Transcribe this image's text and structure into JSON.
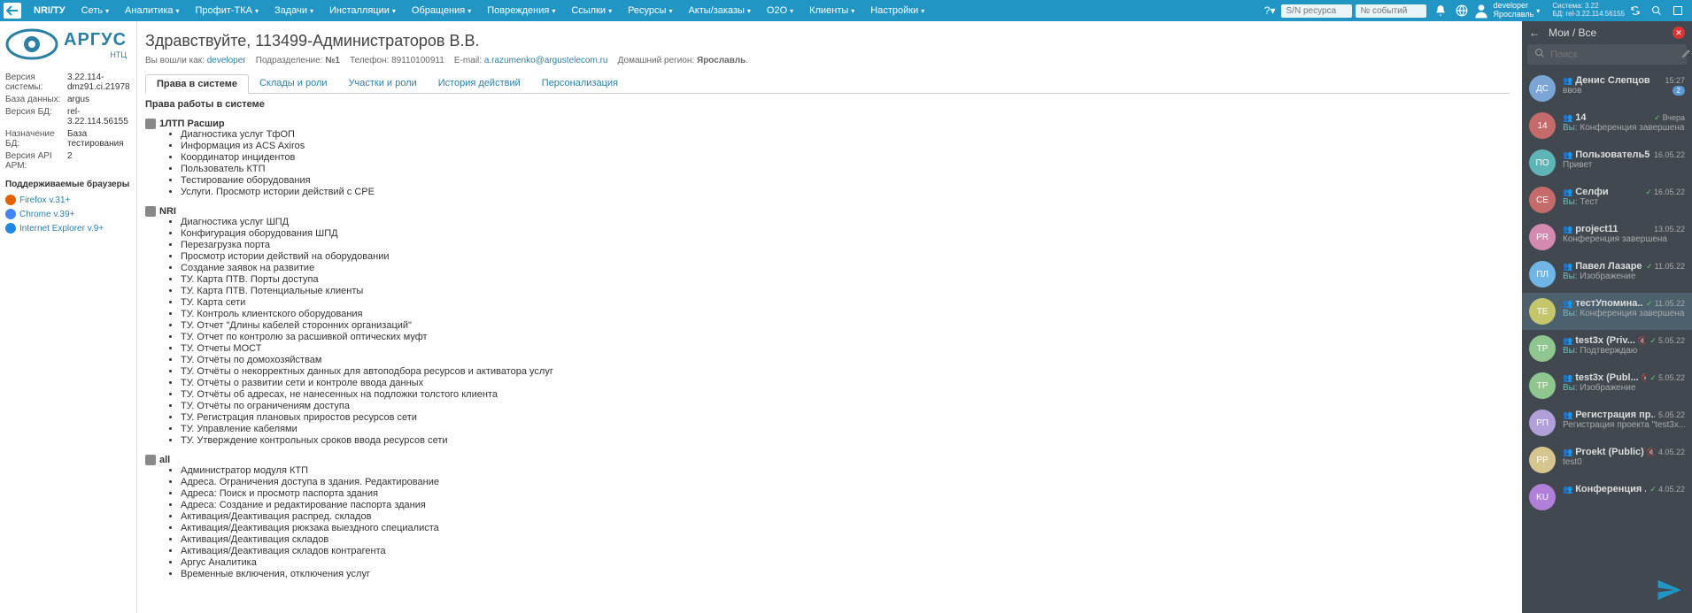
{
  "topbar": {
    "home": "NRI/ТУ",
    "menu": [
      "Сеть",
      "Аналитика",
      "Профит-ТКА",
      "Задачи",
      "Инсталляции",
      "Обращения",
      "Повреждения",
      "Ссылки",
      "Ресурсы",
      "Акты/заказы",
      "О2О",
      "Клиенты",
      "Настройки"
    ],
    "help": "?",
    "search1_ph": "S/N ресурса",
    "search2_ph": "№ событий",
    "user_name": "developer",
    "user_loc": "Ярославль",
    "sys1": "Система: 3.22",
    "sys2": "БД: rel-3.22.114.56155"
  },
  "left": {
    "brand": "АРГУС",
    "brand_sub": "НТЦ",
    "rows": [
      {
        "l": "Версия системы:",
        "v": "3.22.114-dmz91.ci.21978"
      },
      {
        "l": "База данных:",
        "v": "argus"
      },
      {
        "l": "Версия БД:",
        "v": "rel-3.22.114.56155"
      },
      {
        "l": "Назначение БД:",
        "v": "База тестирования"
      },
      {
        "l": "Версия API АРМ:",
        "v": "2"
      }
    ],
    "browsers_h": "Поддерживаемые браузеры",
    "browsers": [
      {
        "n": "Firefox v.31+",
        "c": "#e66000"
      },
      {
        "n": "Chrome v.39+",
        "c": "#4285f4"
      },
      {
        "n": "Internet Explorer v.9+",
        "c": "#1e88e5"
      }
    ]
  },
  "main": {
    "greeting": "Здравствуйте, 113499-Администраторов В.В.",
    "meta_login_l": "Вы вошли как: ",
    "meta_login_v": "developer",
    "meta_dep_l": "Подразделение: ",
    "meta_dep_v": "№1",
    "meta_tel_l": "Телефон: ",
    "meta_tel_v": "89110100911",
    "meta_mail_l": "E-mail: ",
    "meta_mail_v": "a.razumenko@argustelecom.ru",
    "meta_reg_l": "Домашний регион: ",
    "meta_reg_v": "Ярославль",
    "tabs": [
      "Права в системе",
      "Склады и роли",
      "Участки и роли",
      "История действий",
      "Персонализация"
    ],
    "section_title": "Права работы в системе",
    "groups": [
      {
        "h": "1ЛТП Расшир",
        "items": [
          "Диагностика услуг ТфОП",
          "Информация из ACS Axiros",
          "Координатор инцидентов",
          "Пользователь КТП",
          "Тестирование оборудования",
          "Услуги. Просмотр истории действий с CPE"
        ]
      },
      {
        "h": "NRI",
        "items": [
          "Диагностика услуг ШПД",
          "Конфигурация оборудования ШПД",
          "Перезагрузка порта",
          "Просмотр истории действий на оборудовании",
          "Создание заявок на развитие",
          "ТУ. Карта ПТВ. Порты доступа",
          "ТУ. Карта ПТВ. Потенциальные клиенты",
          "ТУ. Карта сети",
          "ТУ. Контроль клиентского оборудования",
          "ТУ. Отчет \"Длины кабелей сторонних организаций\"",
          "ТУ. Отчет по контролю за расшивкой оптических муфт",
          "ТУ. Отчеты МОСТ",
          "ТУ. Отчёты по домохозяйствам",
          "ТУ. Отчёты о некорректных данных для автоподбора ресурсов и активатора услуг",
          "ТУ. Отчёты о развитии сети и контроле ввода данных",
          "ТУ. Отчёты об адресах, не нанесенных на подложки толстого клиента",
          "ТУ. Отчёты по ограничениям доступа",
          "ТУ. Регистрация плановых приростов ресурсов сети",
          "ТУ. Управление кабелями",
          "ТУ. Утверждение контрольных сроков ввода ресурсов сети"
        ]
      },
      {
        "h": "all",
        "items": [
          "Администратор модуля КТП",
          "Адреса. Ограничения доступа в здания. Редактирование",
          "Адреса: Поиск и просмотр паспорта здания",
          "Адреса: Создание и редактирование паспорта здания",
          "Активация/Деактивация распред. складов",
          "Активация/Деактивация рюкзака выездного специалиста",
          "Активация/Деактивация складов",
          "Активация/Деактивация складов контрагента",
          "Аргус Аналитика",
          "Временные включения, отключения услуг"
        ]
      }
    ]
  },
  "right": {
    "title": "Мои / Все",
    "search_ph": "Поиск",
    "chats": [
      {
        "a": "ДС",
        "ac": "#7aa5d4",
        "n": "Денис Слепцов",
        "t": "15:27",
        "m": "ввов",
        "g": true,
        "badge": "2"
      },
      {
        "a": "14",
        "ac": "#c56b6b",
        "n": "14",
        "t": "Вчера",
        "m": "Вы: Конференция завершена",
        "g": true,
        "ck": true
      },
      {
        "a": "ПО",
        "ac": "#5fb5b5",
        "n": "Пользователь5",
        "t": "16.05.22",
        "m": "Привет",
        "g": true
      },
      {
        "a": "СЕ",
        "ac": "#c56b6b",
        "n": "Селфи",
        "t": "16.05.22",
        "m": "Вы: Тест",
        "g": true,
        "ck": true
      },
      {
        "a": "PR",
        "ac": "#d48ab0",
        "n": "project11",
        "t": "13.05.22",
        "m": "Конференция завершена",
        "g": true
      },
      {
        "a": "ПЛ",
        "ac": "#6fb5e5",
        "n": "Павел Лазарев",
        "t": "11.05.22",
        "m": "Вы: Изображение",
        "g": true,
        "ck": true
      },
      {
        "a": "TE",
        "ac": "#c5c56b",
        "n": "тестУпомина...",
        "t": "11.05.22",
        "m": "Вы: Конференция завершена",
        "g": true,
        "ck": true,
        "active": true
      },
      {
        "a": "TP",
        "ac": "#8fc58f",
        "n": "test3x (Priv...",
        "t": "5.05.22",
        "m": "Вы: Подтверждаю",
        "g": true,
        "ck": true,
        "mute": true
      },
      {
        "a": "TP",
        "ac": "#8fc58f",
        "n": "test3x (Publ...",
        "t": "5.05.22",
        "m": "Вы: Изображение",
        "g": true,
        "ck": true,
        "mute": true
      },
      {
        "a": "РП",
        "ac": "#b09fd8",
        "n": "Регистрация пр...",
        "t": "5.05.22",
        "m": "Регистрация проекта \"test3x...",
        "g": true
      },
      {
        "a": "PP",
        "ac": "#d5c58f",
        "n": "Proekt (Public)",
        "t": "4.05.22",
        "m": "test0",
        "g": true,
        "mute": true
      },
      {
        "a": "KU",
        "ac": "#b07fd8",
        "n": "Конференция ...",
        "t": "4.05.22",
        "m": "",
        "g": true,
        "ck": true
      }
    ]
  }
}
